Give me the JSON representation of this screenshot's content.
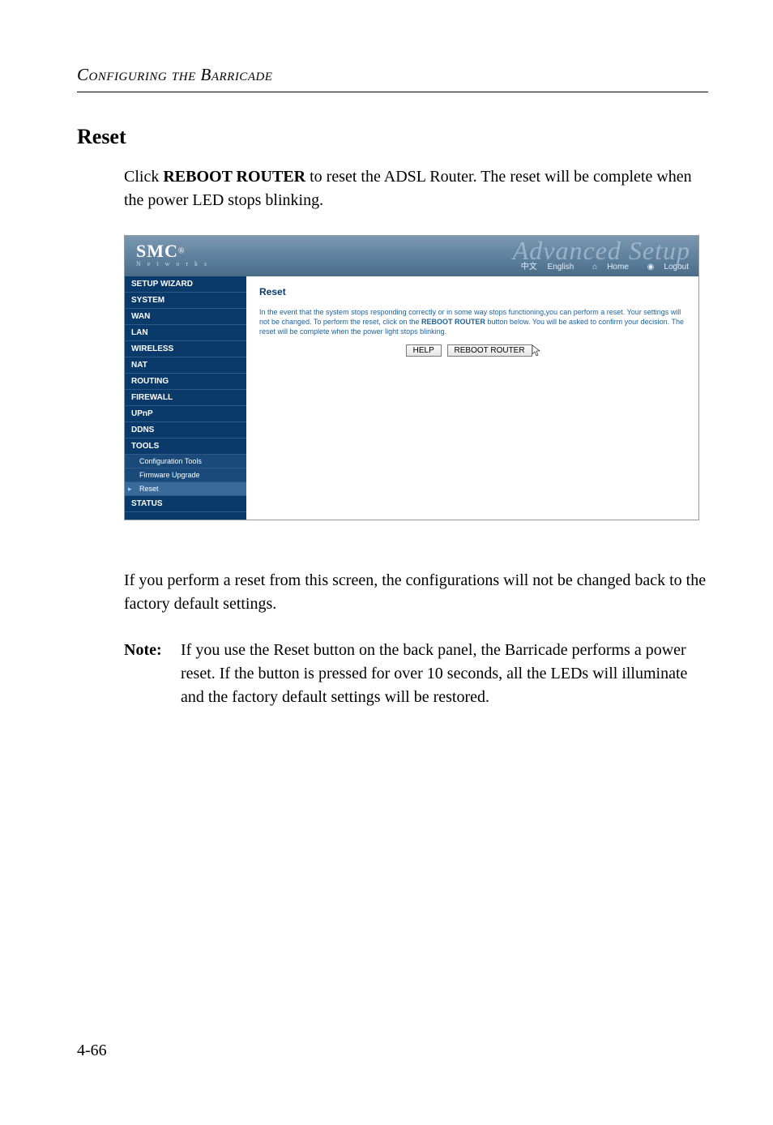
{
  "running_header": "Configuring the Barricade",
  "section_title": "Reset",
  "intro": {
    "prefix": "Click ",
    "bold": "REBOOT ROUTER",
    "suffix": " to reset the ADSL Router. The reset will be complete when the power LED stops blinking."
  },
  "screenshot": {
    "logo": {
      "text": "SMC",
      "reg": "®",
      "sub": "N e t w o r k s"
    },
    "watermark": "Advanced Setup",
    "toplinks": {
      "lang_cn": "中文",
      "lang_en": "English",
      "home": "Home",
      "logout": "Logout"
    },
    "sidebar": {
      "items": [
        "SETUP WIZARD",
        "SYSTEM",
        "WAN",
        "LAN",
        "WIRELESS",
        "NAT",
        "ROUTING",
        "FIREWALL",
        "UPnP",
        "DDNS",
        "TOOLS"
      ],
      "subitems": [
        "Configuration Tools",
        "Firmware Upgrade",
        "Reset"
      ],
      "items_tail": [
        "STATUS"
      ]
    },
    "content": {
      "title": "Reset",
      "desc_before": "In the event that the system stops responding correctly or in some way stops functioning,you can perform a reset. Your settings will not be changed. To perform the reset, click on the ",
      "desc_bold": "REBOOT ROUTER",
      "desc_after": " button below. You will be asked to confirm your decision. The reset will be complete when the power light stops blinking.",
      "buttons": {
        "help": "HELP",
        "reboot": "REBOOT ROUTER"
      }
    }
  },
  "after_text": "If you perform a reset from this screen, the configurations will not be changed back to the factory default settings.",
  "note": {
    "label": "Note:",
    "body": "If you use the Reset button on the back panel, the Barricade performs a power reset. If the button is pressed for over 10 seconds, all the LEDs will illuminate and the factory default settings will be restored."
  },
  "page_number": "4-66"
}
